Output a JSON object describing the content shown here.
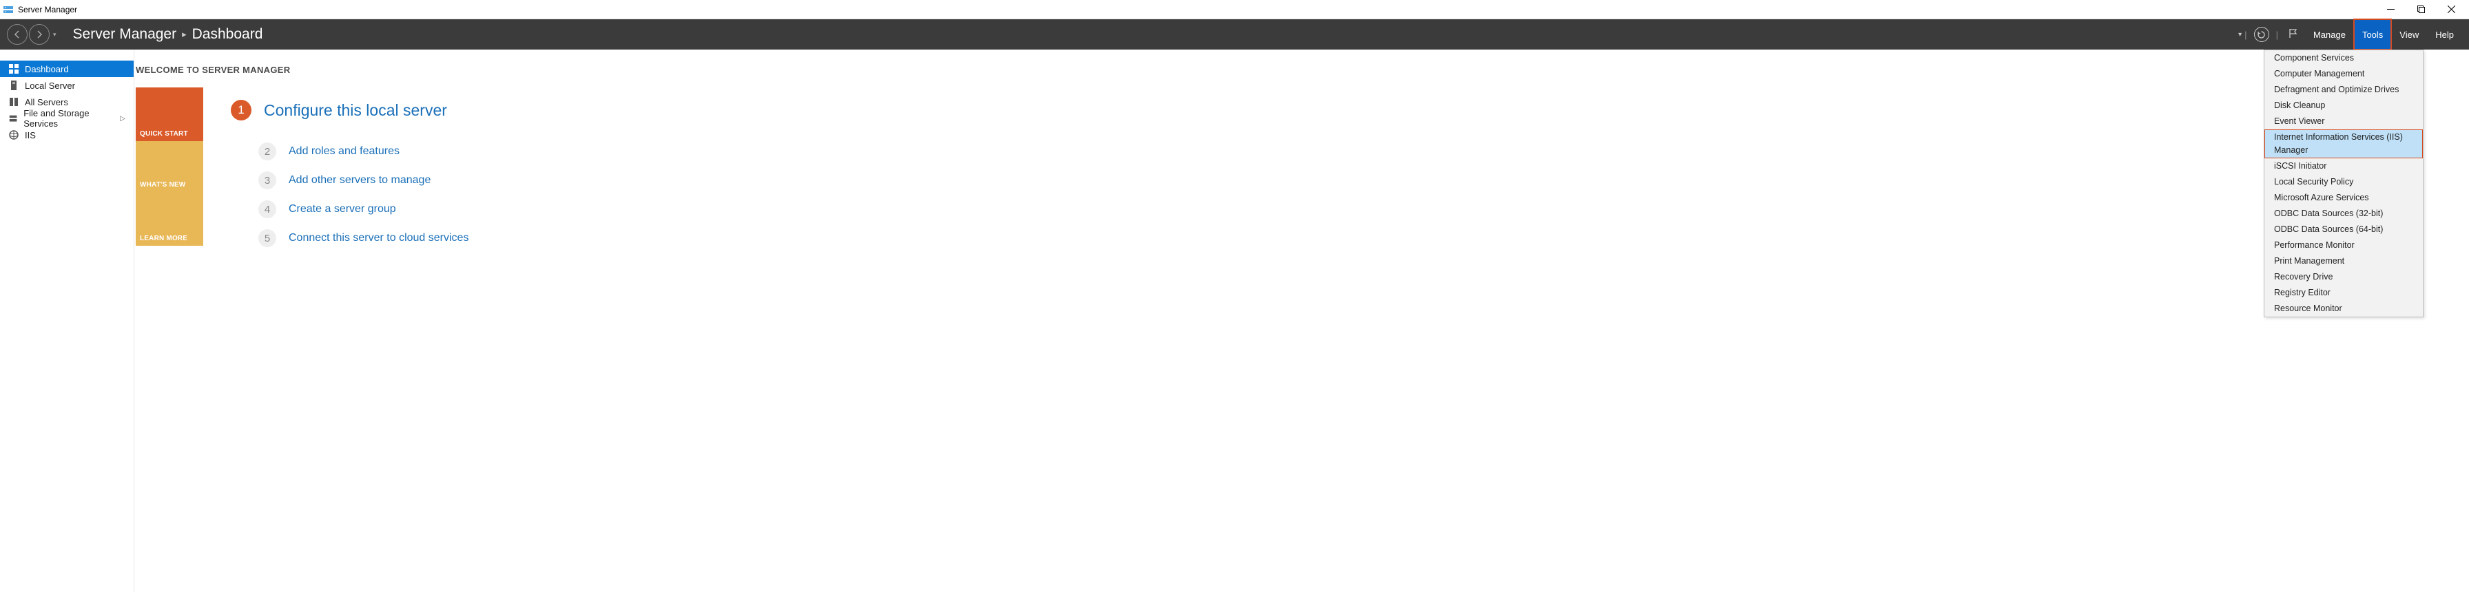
{
  "titlebar": {
    "title": "Server Manager"
  },
  "header": {
    "breadcrumb_root": "Server Manager",
    "breadcrumb_page": "Dashboard",
    "menu": {
      "manage": "Manage",
      "tools": "Tools",
      "view": "View",
      "help": "Help"
    }
  },
  "sidebar": {
    "items": [
      {
        "label": "Dashboard"
      },
      {
        "label": "Local Server"
      },
      {
        "label": "All Servers"
      },
      {
        "label": "File and Storage Services"
      },
      {
        "label": "IIS"
      }
    ]
  },
  "main": {
    "welcome": "WELCOME TO SERVER MANAGER",
    "tiles": {
      "quick_start": "QUICK START",
      "whats_new": "WHAT'S NEW",
      "learn_more": "LEARN MORE"
    },
    "steps": [
      {
        "n": "1",
        "text": "Configure this local server"
      },
      {
        "n": "2",
        "text": "Add roles and features"
      },
      {
        "n": "3",
        "text": "Add other servers to manage"
      },
      {
        "n": "4",
        "text": "Create a server group"
      },
      {
        "n": "5",
        "text": "Connect this server to cloud services"
      }
    ]
  },
  "tools_menu": [
    "Component Services",
    "Computer Management",
    "Defragment and Optimize Drives",
    "Disk Cleanup",
    "Event Viewer",
    "Internet Information Services (IIS) Manager",
    "iSCSI Initiator",
    "Local Security Policy",
    "Microsoft Azure Services",
    "ODBC Data Sources (32-bit)",
    "ODBC Data Sources (64-bit)",
    "Performance Monitor",
    "Print Management",
    "Recovery Drive",
    "Registry Editor",
    "Resource Monitor"
  ],
  "tools_menu_highlight_index": 5
}
